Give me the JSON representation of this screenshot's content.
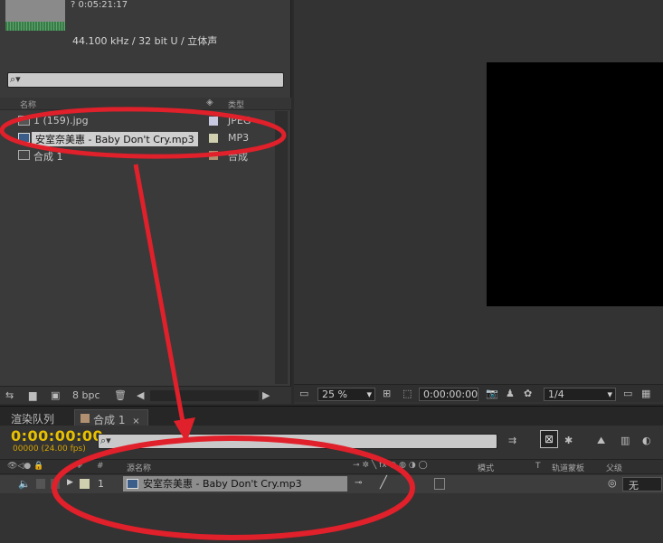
{
  "project": {
    "duration": "? 0:05:21:17",
    "audio_info": "44.100 kHz / 32 bit U / 立体声",
    "search_placeholder": "",
    "columns": {
      "name": "名称",
      "type": "类型"
    },
    "items": [
      {
        "name": "1 (159).jpg",
        "type": "JPEG",
        "icon": "image-file-icon",
        "label_color": "#c8c8e0"
      },
      {
        "name": "安室奈美惠 - Baby Don't Cry.mp3",
        "type": "MP3",
        "icon": "audio-file-icon",
        "label_color": "#d0d0b0"
      },
      {
        "name": "合成 1",
        "type": "合成",
        "icon": "composition-icon",
        "label_color": "#b09070"
      }
    ],
    "bpc": "8 bpc"
  },
  "viewer": {
    "zoom": "25 %",
    "timecode": "0:00:00:00",
    "resolution": "1/4"
  },
  "tabs": [
    {
      "label": "渲染队列"
    },
    {
      "label": "合成 1"
    }
  ],
  "timeline": {
    "timecode": "0:00:00:00",
    "fps": "00000 (24.00 fps)",
    "columns": {
      "num": "#",
      "source_name": "源名称",
      "mode": "模式",
      "t": "T",
      "trkmat": "轨道蒙板",
      "parent": "父级"
    },
    "layer": {
      "index": "1",
      "name": "安室奈美惠 - Baby Don't Cry.mp3",
      "parent": "无"
    }
  },
  "annotation_color": "#e0202a"
}
